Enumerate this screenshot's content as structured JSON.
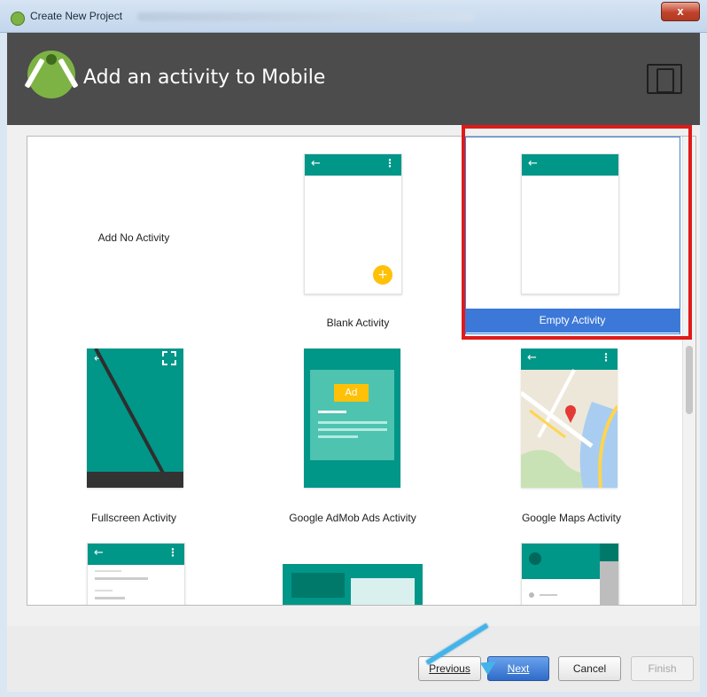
{
  "window": {
    "title": "Create New Project",
    "close_glyph": "x"
  },
  "banner": {
    "title": "Add an activity to Mobile",
    "logo_icon": "android-studio-icon",
    "device_icon": "phone-tablet-icon"
  },
  "gallery": {
    "items": [
      {
        "label": "Add No Activity"
      },
      {
        "label": "Blank Activity"
      },
      {
        "label": "Empty Activity",
        "selected": true
      },
      {
        "label": "Fullscreen Activity"
      },
      {
        "label": "Google AdMob Ads Activity",
        "ad_badge": "Ad"
      },
      {
        "label": "Google Maps Activity"
      }
    ]
  },
  "buttons": {
    "previous": "Previous",
    "next": "Next",
    "cancel": "Cancel",
    "finish": "Finish"
  },
  "colors": {
    "teal": "#009688",
    "selection_blue": "#3c78d8",
    "highlight_red": "#e01a1a",
    "fab_yellow": "#ffc107"
  }
}
